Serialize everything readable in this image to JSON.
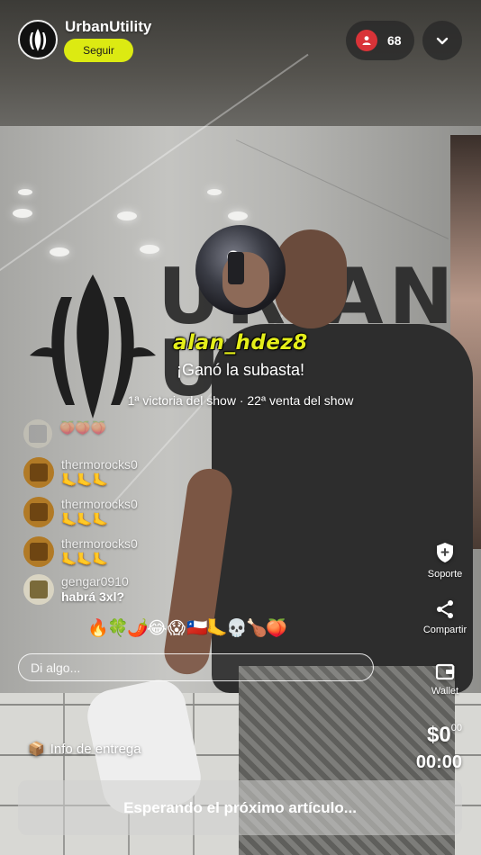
{
  "header": {
    "channel_name": "UrbanUtility",
    "follow_label": "Seguir",
    "viewer_count": "68",
    "colors": {
      "follow_bg": "#dcea12",
      "viewer_badge": "#d93338"
    }
  },
  "winner": {
    "username": "alan_hdez8",
    "message": "¡Ganó la subasta!",
    "stats": "1ª victoria del show · 22ª venta del show"
  },
  "chat": {
    "messages": [
      {
        "user": "",
        "text": "🍑🍑🍑",
        "avatar": "faded-avatar"
      },
      {
        "user": "thermorocks0",
        "text": "🦶🦶🦶",
        "avatar": "thermo-avatar"
      },
      {
        "user": "thermorocks0",
        "text": "🦶🦶🦶",
        "avatar": "thermo-avatar"
      },
      {
        "user": "thermorocks0",
        "text": "🦶🦶🦶",
        "avatar": "thermo-avatar"
      },
      {
        "user": "gengar0910",
        "text": "habrá 3xl?",
        "avatar": "pixel-avatar"
      }
    ],
    "quick_emojis": [
      "🔥",
      "🍀",
      "🌶️",
      "😂",
      "😱",
      "🇨🇱",
      "🦶",
      "💀",
      "🍗",
      "🍑"
    ],
    "input_placeholder": "Di algo..."
  },
  "side_actions": {
    "support_label": "Soporte",
    "share_label": "Compartir",
    "wallet_label": "Wallet"
  },
  "bottom": {
    "delivery_icon": "📦",
    "delivery_label": "Info de entrega",
    "price_main": "$0",
    "price_cents": "00",
    "timer": "00:00",
    "status_button": "Esperando el próximo artículo..."
  },
  "icons": [
    "person-icon",
    "chevron-down-icon",
    "shield-plus-icon",
    "share-icon",
    "wallet-icon",
    "package-icon"
  ]
}
